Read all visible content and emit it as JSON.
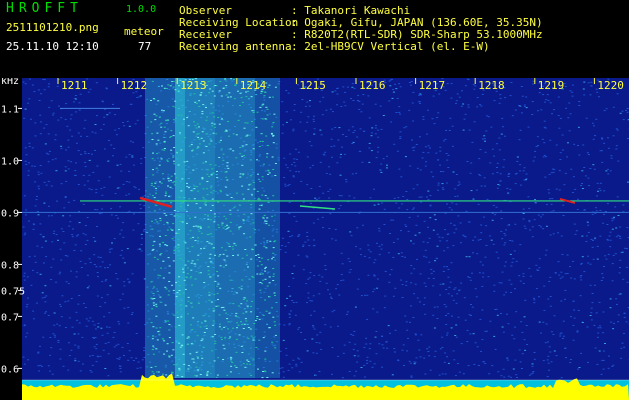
{
  "header": {
    "app_title": "HROFFT",
    "version": "1.0.0",
    "filename": "2511101210.png",
    "datetime": "25.11.10 12:10",
    "mode_label": "meteor",
    "count": "77"
  },
  "station": {
    "observer_label": "Observer",
    "observer_value": ": Takanori Kawachi",
    "location_label": "Receiving Location",
    "location_value": ": Ogaki, Gifu, JAPAN (136.60E, 35.35N)",
    "receiver_label": "Receiver",
    "receiver_value": ": R820T2(RTL-SDR) SDR-Sharp 53.1000MHz",
    "antenna_label": "Receiving antenna",
    "antenna_value": ": 2el-HB9CV Vertical (el. E-W)"
  },
  "spectrogram": {
    "y_unit": "kHz",
    "y_ticks": [
      "1.1",
      "1.0",
      "0.9",
      "0.8",
      "0.75",
      "0.7",
      "0.6"
    ],
    "y_values": [
      1.1,
      1.0,
      0.9,
      0.8,
      0.75,
      0.7,
      0.6
    ],
    "x_ticks": [
      "1211",
      "1212",
      "1213",
      "1214",
      "1215",
      "1216",
      "1217",
      "1218",
      "1219",
      "1220"
    ],
    "colors": {
      "background": "#0a1a8a",
      "noise": "#1e50d0",
      "bright": "#30d0e0",
      "echo": "#e02020",
      "trace": "#30e080",
      "tick": "#ffff40",
      "baseline": "#ffff00"
    }
  }
}
